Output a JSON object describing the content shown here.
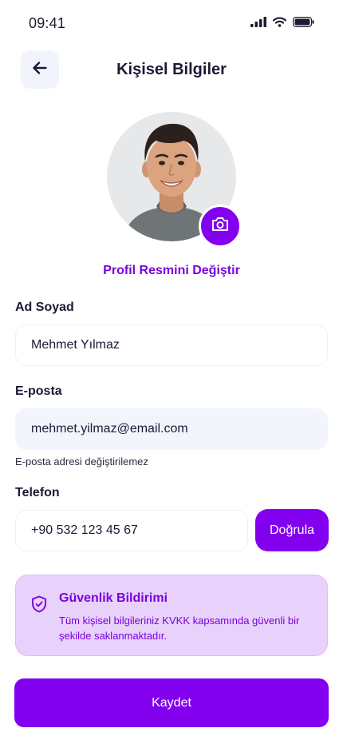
{
  "status_bar": {
    "time": "09:41",
    "icons": [
      "signal-icon",
      "wifi-icon",
      "battery-icon"
    ]
  },
  "header": {
    "title": "Kişisel Bilgiler",
    "back_icon": "arrow-left-icon"
  },
  "profile": {
    "change_photo_label": "Profil Resmini Değiştir",
    "camera_icon": "camera-icon"
  },
  "form": {
    "name": {
      "label": "Ad Soyad",
      "value": "Mehmet Yılmaz"
    },
    "email": {
      "label": "E-posta",
      "value": "mehmet.yilmaz@email.com",
      "hint": "E-posta adresi değiştirilemez"
    },
    "phone": {
      "label": "Telefon",
      "value": "+90 532 123 45 67",
      "verify_label": "Doğrula"
    }
  },
  "notice": {
    "icon": "shield-check-icon",
    "title": "Güvenlik Bildirimi",
    "text": "Tüm kişisel bilgileriniz KVKK kapsamında güvenli bir şekilde saklanmaktadır."
  },
  "actions": {
    "save_label": "Kaydet"
  },
  "colors": {
    "accent": "#8300ef",
    "accent_text": "#7a00df",
    "notice_bg": "#e8d1fb",
    "readonly_bg": "#f2f6fc"
  }
}
